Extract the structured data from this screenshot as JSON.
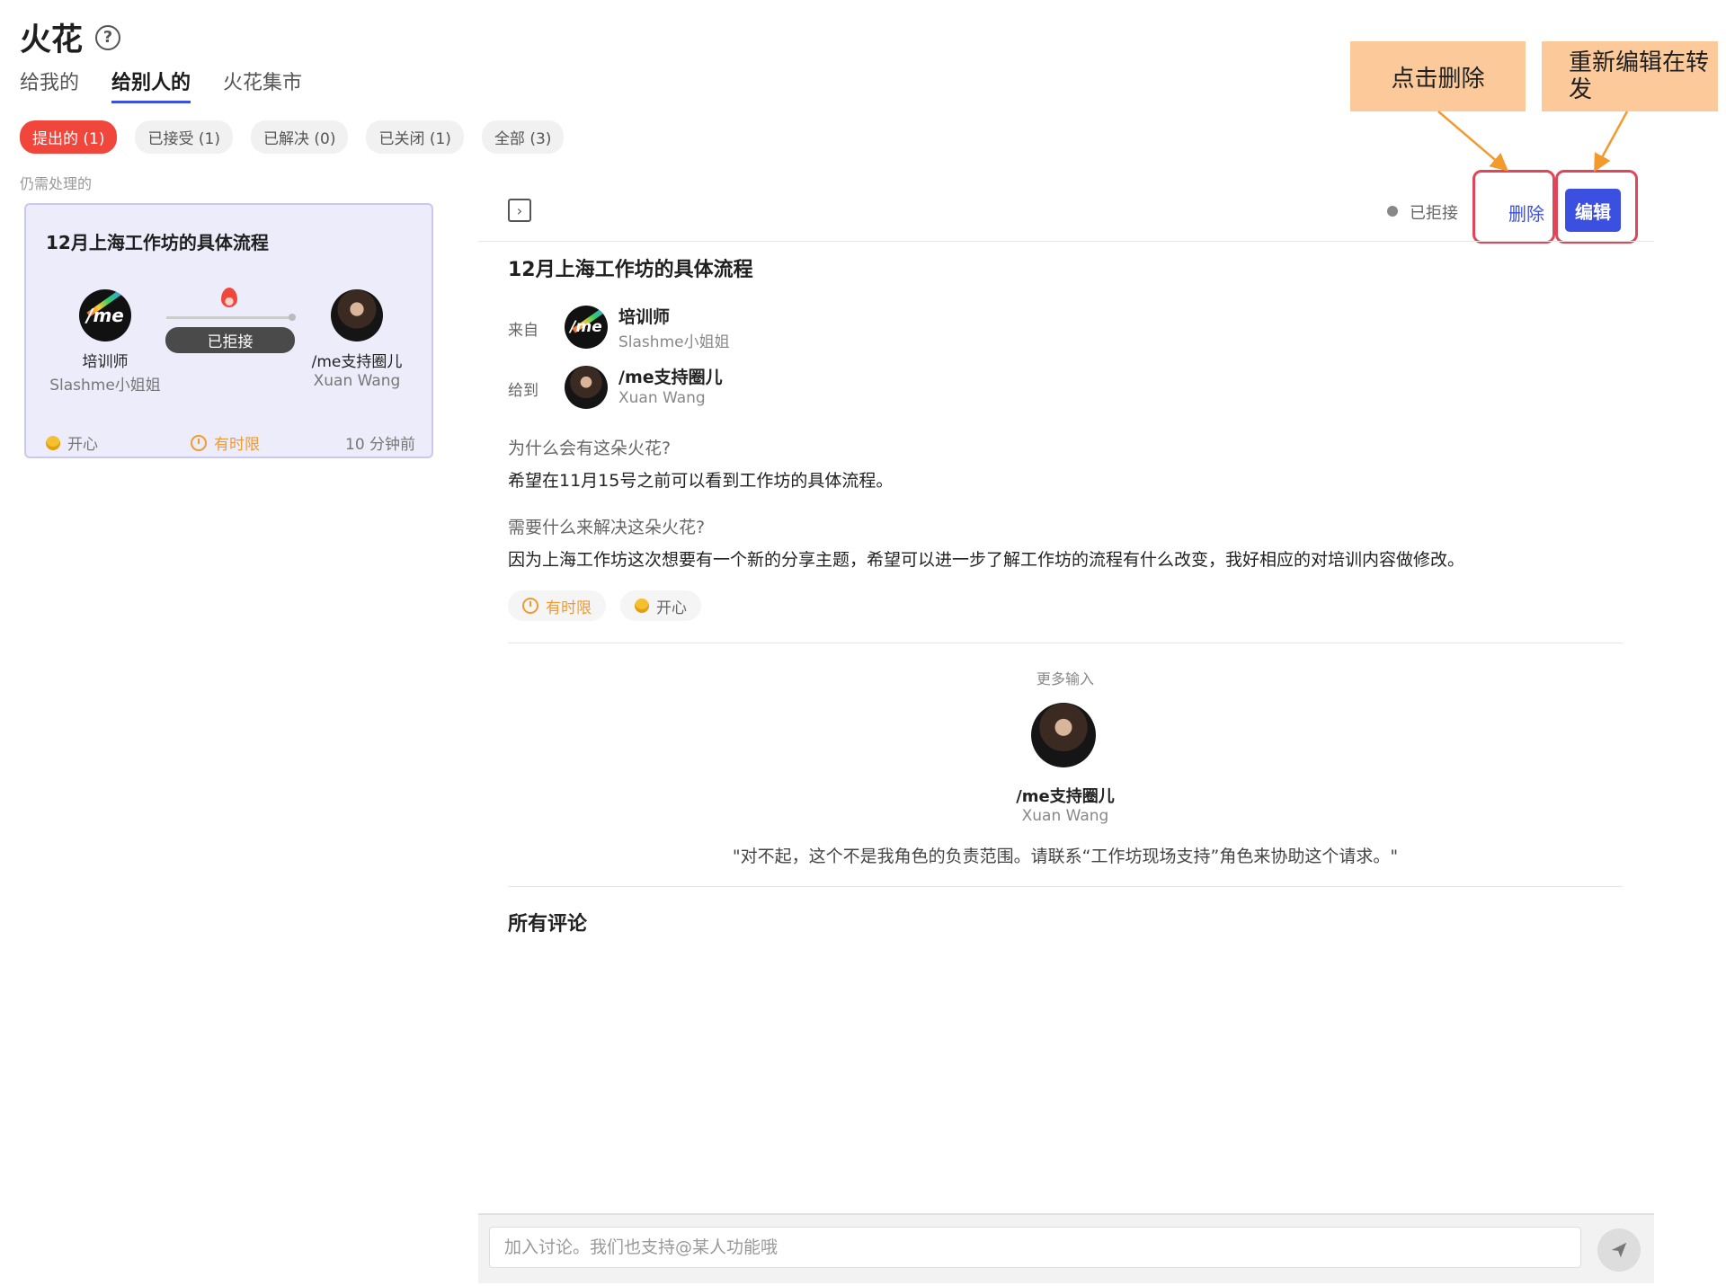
{
  "header": {
    "title": "火花",
    "tabs": [
      {
        "label": "给我的",
        "active": false
      },
      {
        "label": "给别人的",
        "active": true
      },
      {
        "label": "火花集市",
        "active": false
      }
    ],
    "filters": [
      {
        "label": "提出的 (1)",
        "active": true
      },
      {
        "label": "已接受 (1)",
        "active": false
      },
      {
        "label": "已解决 (0)",
        "active": false
      },
      {
        "label": "已关闭 (1)",
        "active": false
      },
      {
        "label": "全部 (3)",
        "active": false
      }
    ]
  },
  "list": {
    "section_label": "仍需处理的",
    "card": {
      "title": "12月上海工作坊的具体流程",
      "from": {
        "name": "培训师",
        "sub": "Slashme小姐姐",
        "avatar_text": "/me"
      },
      "to": {
        "name": "/me支持圈儿",
        "sub": "Xuan Wang"
      },
      "status": "已拒接",
      "mood": "开心",
      "deadline": "有时限",
      "time": "10 分钟前"
    }
  },
  "detail": {
    "status": "已拒接",
    "delete_label": "删除",
    "edit_label": "编辑",
    "title": "12月上海工作坊的具体流程",
    "from_label": "来自",
    "from": {
      "name": "培训师",
      "sub": "Slashme小姐姐",
      "avatar_text": "/me"
    },
    "to_label": "给到",
    "to": {
      "name": "/me支持圈儿",
      "sub": "Xuan Wang"
    },
    "why_q": "为什么会有这朵火花?",
    "why_a": "希望在11月15号之前可以看到工作坊的具体流程。",
    "need_q": "需要什么来解决这朵火花?",
    "need_a": "因为上海工作坊这次想要有一个新的分享主题，希望可以进一步了解工作坊的流程有什么改变，我好相应的对培训内容做修改。",
    "tags": {
      "deadline": "有时限",
      "mood": "开心"
    },
    "more_input": {
      "label": "更多输入",
      "name": "/me支持圈儿",
      "sub": "Xuan Wang",
      "message": "\"对不起，这个不是我角色的负责范围。请联系“工作坊现场支持”角色来协助这个请求。\""
    },
    "comments_title": "所有评论",
    "comment_input": {
      "value": "",
      "placeholder": "加入讨论。我们也支持@某人功能哦"
    }
  },
  "annotations": {
    "delete_callout": "点击删除",
    "edit_callout": "重新编辑在转发"
  },
  "colors": {
    "accent": "#3b4fe0",
    "active_pill": "#f0463c",
    "highlight_border": "#e0455a",
    "callout_bg": "#fbc99a",
    "deadline": "#f29a2e"
  },
  "icons": [
    "help-icon",
    "fire-icon",
    "clock-icon",
    "emoji-icon",
    "toggle-panel-icon",
    "send-icon"
  ]
}
